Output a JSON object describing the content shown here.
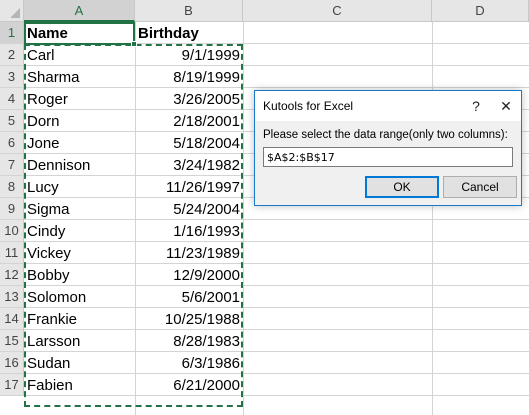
{
  "sheet": {
    "columns": [
      {
        "label": "A",
        "selected": true
      },
      {
        "label": "B",
        "selected": false
      },
      {
        "label": "C",
        "selected": false
      },
      {
        "label": "D",
        "selected": false
      }
    ],
    "row_numbers": [
      "1",
      "2",
      "3",
      "4",
      "5",
      "6",
      "7",
      "8",
      "9",
      "10",
      "11",
      "12",
      "13",
      "14",
      "15",
      "16",
      "17"
    ],
    "headers": {
      "name": "Name",
      "birthday": "Birthday"
    },
    "rows": [
      {
        "name": "Carl",
        "birthday": "9/1/1999"
      },
      {
        "name": "Sharma",
        "birthday": "8/19/1999"
      },
      {
        "name": "Roger",
        "birthday": "3/26/2005"
      },
      {
        "name": "Dorn",
        "birthday": "2/18/2001"
      },
      {
        "name": "Jone",
        "birthday": "5/18/2004"
      },
      {
        "name": "Dennison",
        "birthday": "3/24/1982"
      },
      {
        "name": "Lucy",
        "birthday": "11/26/1997"
      },
      {
        "name": "Sigma",
        "birthday": "5/24/2004"
      },
      {
        "name": "Cindy",
        "birthday": "1/16/1993"
      },
      {
        "name": "Vickey",
        "birthday": "11/23/1989"
      },
      {
        "name": "Bobby",
        "birthday": "12/9/2000"
      },
      {
        "name": "Solomon",
        "birthday": "5/6/2001"
      },
      {
        "name": "Frankie",
        "birthday": "10/25/1988"
      },
      {
        "name": "Larsson",
        "birthday": "8/28/1983"
      },
      {
        "name": "Sudan",
        "birthday": "6/3/1986"
      },
      {
        "name": "Fabien",
        "birthday": "6/21/2000"
      }
    ],
    "accent_color": "#217346"
  },
  "dialog": {
    "title": "Kutools for Excel",
    "help_icon": "?",
    "close_icon": "✕",
    "prompt": "Please select the data range(only two columns):",
    "range_value": "$A$2:$B$17",
    "ok_label": "OK",
    "cancel_label": "Cancel",
    "border_color": "#1979ca"
  }
}
